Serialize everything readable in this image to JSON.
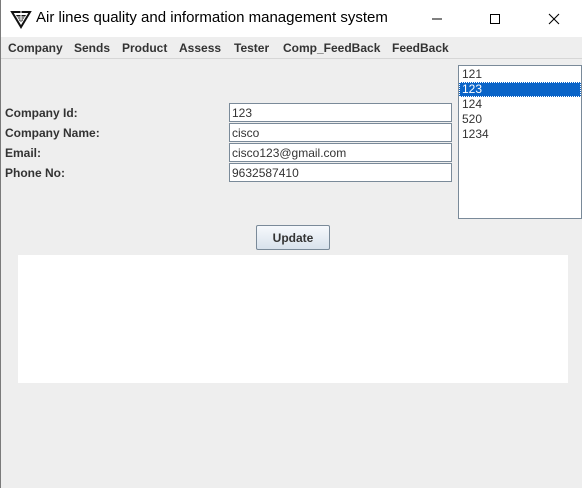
{
  "window": {
    "title": "Air lines quality and information management system",
    "app_icon": "winged-badge-icon",
    "controls": [
      "minimize-icon",
      "maximize-icon",
      "close-icon"
    ]
  },
  "menu": {
    "items": [
      {
        "label": "Company"
      },
      {
        "label": "Sends"
      },
      {
        "label": "Product"
      },
      {
        "label": "Assess"
      },
      {
        "label": "Tester"
      },
      {
        "label": "Comp_FeedBack"
      },
      {
        "label": "FeedBack"
      }
    ]
  },
  "form": {
    "company_id": {
      "label": "Company Id:",
      "value": "123"
    },
    "company_name": {
      "label": "Company Name:",
      "value": "cisco"
    },
    "email": {
      "label": "Email:",
      "value": "cisco123@gmail.com"
    },
    "phone": {
      "label": "Phone No:",
      "value": "9632587410"
    }
  },
  "company_list": {
    "items": [
      "121",
      "123",
      "124",
      "520",
      "1234"
    ],
    "selected": "123"
  },
  "actions": {
    "update_label": "Update"
  },
  "colors": {
    "selection": "#0a64c8",
    "window_bg": "#eeeeee",
    "panel_bg": "#ffffff"
  }
}
